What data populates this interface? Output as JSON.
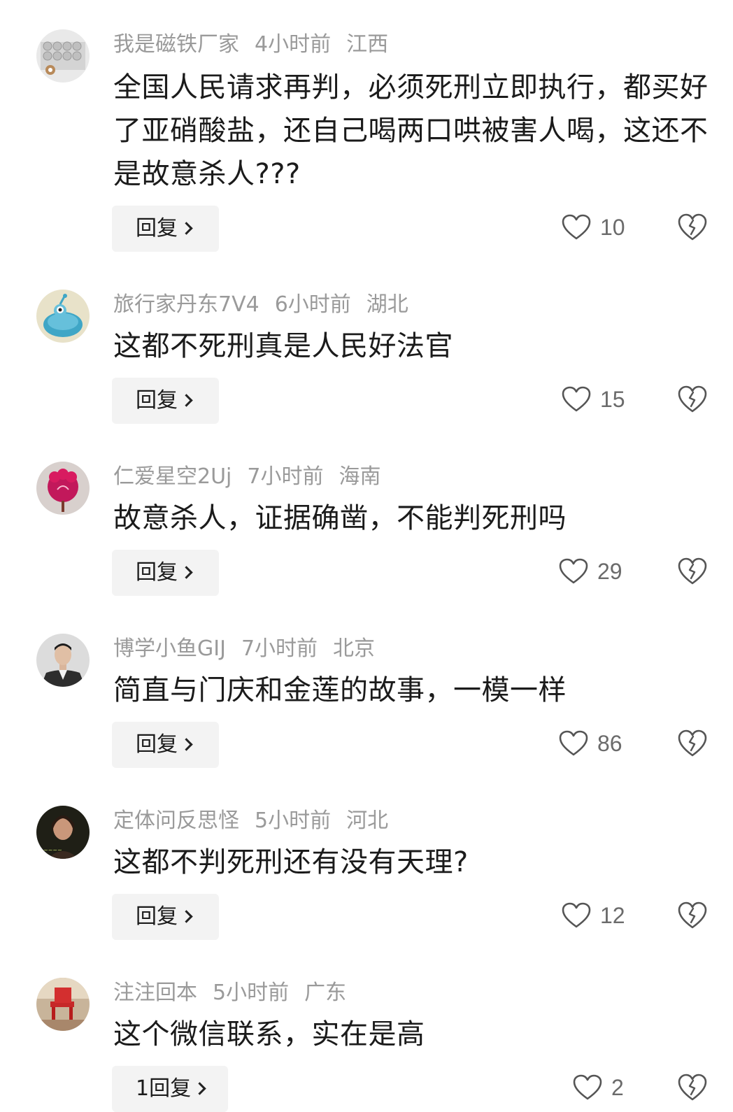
{
  "reply_label": "回复",
  "comments": [
    {
      "username": "我是磁铁厂家",
      "time": "4小时前",
      "location": "江西",
      "text": "全国人民请求再判，必须死刑立即执行，都买好了亚硝酸盐，还自己喝两口哄被害人喝，这还不是故意杀人???",
      "likes": "10",
      "reply_label": "回复",
      "avatar_icon": "magnets-photo"
    },
    {
      "username": "旅行家丹东7V4",
      "time": "6小时前",
      "location": "湖北",
      "text": "这都不死刑真是人民好法官",
      "likes": "15",
      "reply_label": "回复",
      "avatar_icon": "cartoon-creature"
    },
    {
      "username": "仁爱星空2Uj",
      "time": "7小时前",
      "location": "海南",
      "text": "故意杀人，证据确凿，不能判死刑吗",
      "likes": "29",
      "reply_label": "回复",
      "avatar_icon": "red-flower"
    },
    {
      "username": "博学小鱼GIJ",
      "time": "7小时前",
      "location": "北京",
      "text": "简直与门庆和金莲的故事，一模一样",
      "likes": "86",
      "reply_label": "回复",
      "avatar_icon": "man-in-suit"
    },
    {
      "username": "定体问反思怪",
      "time": "5小时前",
      "location": "河北",
      "text": "这都不判死刑还有没有天理?",
      "likes": "12",
      "reply_label": "回复",
      "avatar_icon": "woman-portrait"
    },
    {
      "username": "注注回本",
      "time": "5小时前",
      "location": "广东",
      "text": "这个微信联系，实在是高",
      "likes": "2",
      "reply_label": "1回复",
      "avatar_icon": "red-chair-scene"
    }
  ],
  "colors": {
    "meta_text": "#9a9a9a",
    "body_text": "#1b1b1b",
    "reply_bg": "#f3f3f3",
    "icon_stroke": "#555555"
  }
}
